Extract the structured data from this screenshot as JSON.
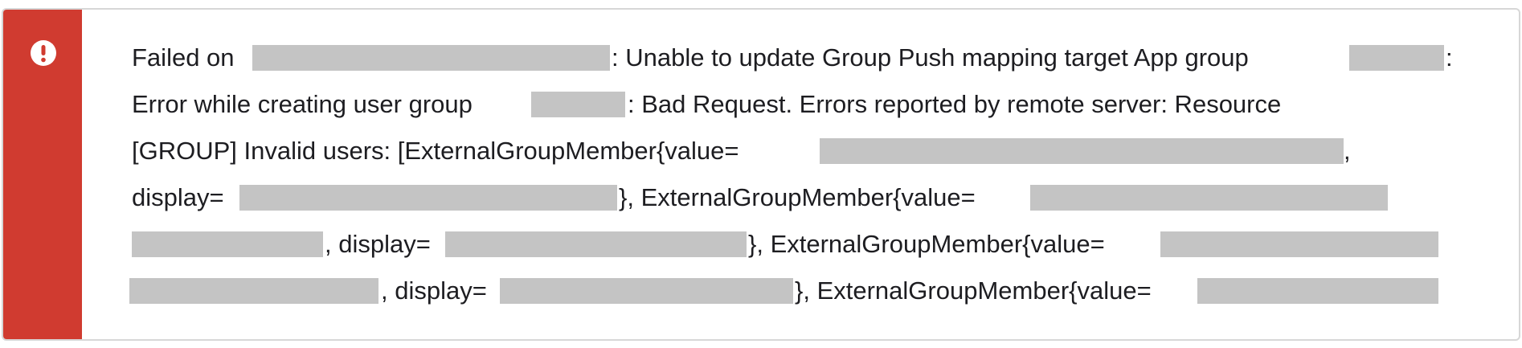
{
  "alert": {
    "icon": "exclamation-circle-icon",
    "accent_color": "#d03b30",
    "border_color": "#d7d7d7",
    "redaction_color": "#c4c4c4",
    "line1": {
      "t1": "Failed on",
      "t2": ": Unable to update Group Push mapping target App group",
      "t3": ":"
    },
    "line2": {
      "t1": "Error while creating user group",
      "t2": ": Bad Request. Errors reported by remote server: Resource"
    },
    "line3": {
      "t1": "[GROUP] Invalid users: [ExternalGroupMember{value=",
      "t2": ","
    },
    "line4": {
      "t1": "display=",
      "t2": "}, ExternalGroupMember{value="
    },
    "line5": {
      "t1": ", display=",
      "t2": "}, ExternalGroupMember{value="
    },
    "line6": {
      "t1": ", display=",
      "t2": "}, ExternalGroupMember{value="
    }
  }
}
